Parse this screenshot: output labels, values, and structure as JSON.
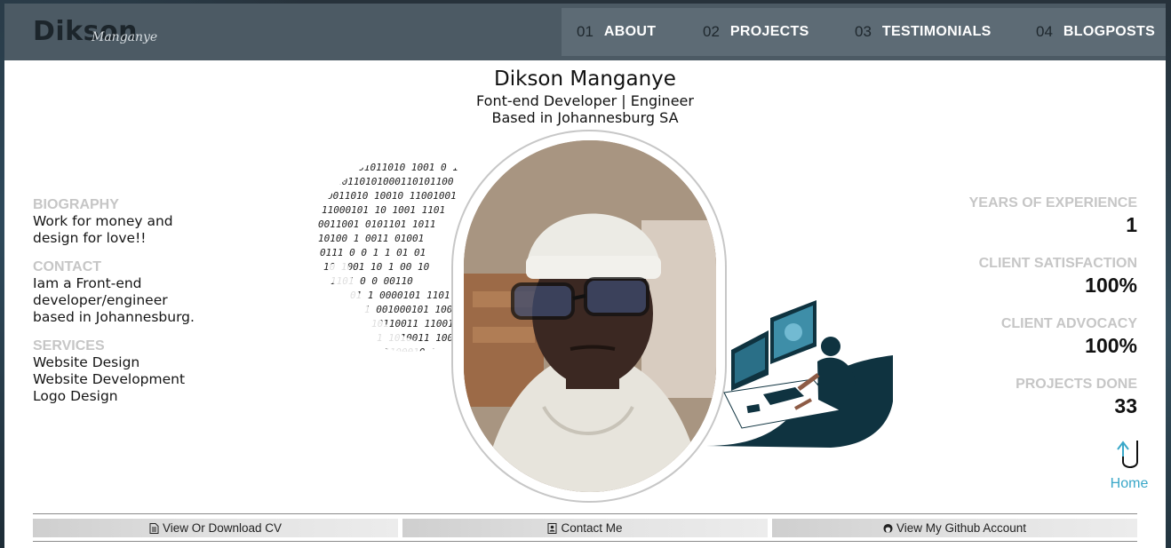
{
  "header": {
    "logo_main": "Dikson",
    "logo_script": "Manganye",
    "nav": [
      {
        "num": "01",
        "label": "ABOUT"
      },
      {
        "num": "02",
        "label": "PROJECTS"
      },
      {
        "num": "03",
        "label": "TESTIMONIALS"
      },
      {
        "num": "04",
        "label": "BLOGPOSTS"
      }
    ]
  },
  "intro": {
    "name": "Dikson Manganye",
    "role": "Font-end Developer | Engineer",
    "location": "Based in Johannesburg SA"
  },
  "left": {
    "biography_title": "BIOGRAPHY",
    "biography_text": "Work for money and design for love!!",
    "contact_title": "CONTACT",
    "contact_text": "Iam a Front-end developer/engineer based in Johannesburg.",
    "services_title": "SERVICES",
    "services": [
      "Website Design",
      "Website Development",
      "Logo Design"
    ]
  },
  "stats": [
    {
      "label": "YEARS OF EXPERIENCE",
      "value": "1"
    },
    {
      "label": "CLIENT SATISFACTION",
      "value": "100%"
    },
    {
      "label": "CLIENT ADVOCACY",
      "value": "100%"
    },
    {
      "label": "PROJECTS DONE",
      "value": "33"
    }
  ],
  "home": {
    "label": "Home",
    "icon": "u-turn-arrow-icon"
  },
  "buttons": [
    {
      "label": "View Or Download CV",
      "icon": "document-icon"
    },
    {
      "label": "Contact Me",
      "icon": "contact-card-icon"
    },
    {
      "label": "View My Github Account",
      "icon": "github-icon"
    }
  ],
  "colors": {
    "header_bg": "#4c5a64",
    "nav_bg": "#5d6b75",
    "accent": "#39a7c8",
    "muted_title": "#c6c6c6",
    "illustration_dark": "#0f3340"
  }
}
